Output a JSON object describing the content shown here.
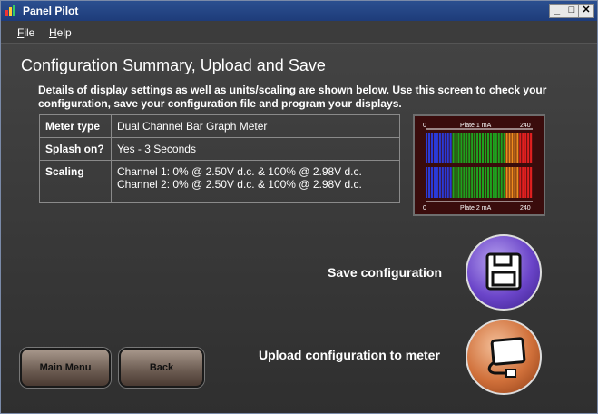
{
  "app": {
    "title": "Panel Pilot"
  },
  "window_controls": {
    "minimize": "_",
    "maximize": "□",
    "close": "✕"
  },
  "menu": {
    "file_u": "F",
    "file_rest": "ile",
    "help_u": "H",
    "help_rest": "elp"
  },
  "page": {
    "heading": "Configuration Summary, Upload and Save",
    "description": "Details of display settings as well as units/scaling are shown below. Use this screen to check your configuration, save your configuration file and program your displays."
  },
  "summary": {
    "meter_type_label": "Meter type",
    "meter_type_value": "Dual Channel Bar Graph Meter",
    "splash_label": "Splash on?",
    "splash_value": "Yes - 3 Seconds",
    "scaling_label": "Scaling",
    "scaling_ch1": "Channel 1: 0% @ 2.50V d.c. & 100% @ 2.98V d.c.",
    "scaling_ch2": "Channel 2: 0% @ 2.50V d.c. & 100% @ 2.98V d.c."
  },
  "preview": {
    "top_label": "Plate 1 mA",
    "bottom_label": "Plate 2 mA",
    "min": "0",
    "max": "240",
    "colors": {
      "blue": "#2a3ad8",
      "green": "#1ea21e",
      "orange": "#f08c1e",
      "red": "#e02020"
    }
  },
  "actions": {
    "save_label": "Save configuration",
    "upload_label": "Upload configuration to meter"
  },
  "nav": {
    "main_menu": "Main Menu",
    "back": "Back"
  }
}
